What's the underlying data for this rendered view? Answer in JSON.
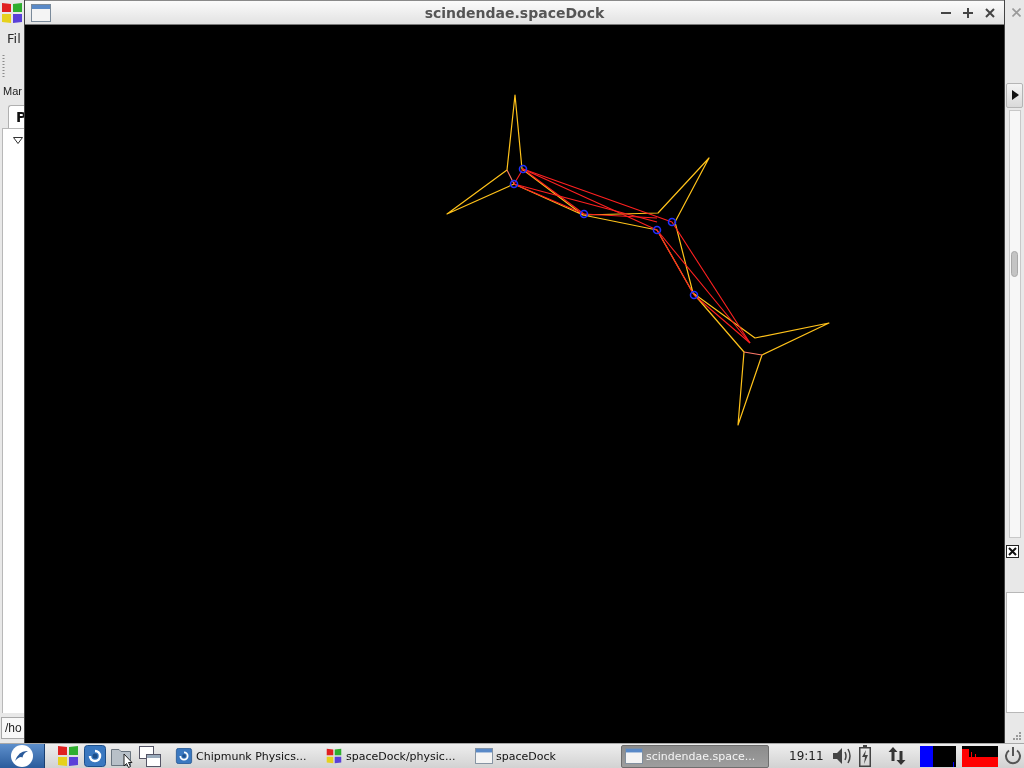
{
  "background_window": {
    "menu": [
      {
        "label": "Fil"
      }
    ],
    "panel_label": "Mar",
    "tabs": [
      {
        "label": "P",
        "selected": true
      }
    ],
    "tree": {
      "expanded": true
    },
    "path_field": {
      "value": "/ho"
    }
  },
  "window": {
    "title": "scindendae.spaceDock"
  },
  "taskbar": {
    "tasks": [
      {
        "label": "Chipmunk Physics...",
        "kind": "swirl",
        "selected": false
      },
      {
        "label": "spaceDock/physic...",
        "kind": "tiles",
        "selected": false
      },
      {
        "label": "spaceDock",
        "kind": "window",
        "selected": false
      },
      {
        "label": "scindendae.space...",
        "kind": "window",
        "selected": true
      }
    ],
    "clock": "19:11"
  }
}
